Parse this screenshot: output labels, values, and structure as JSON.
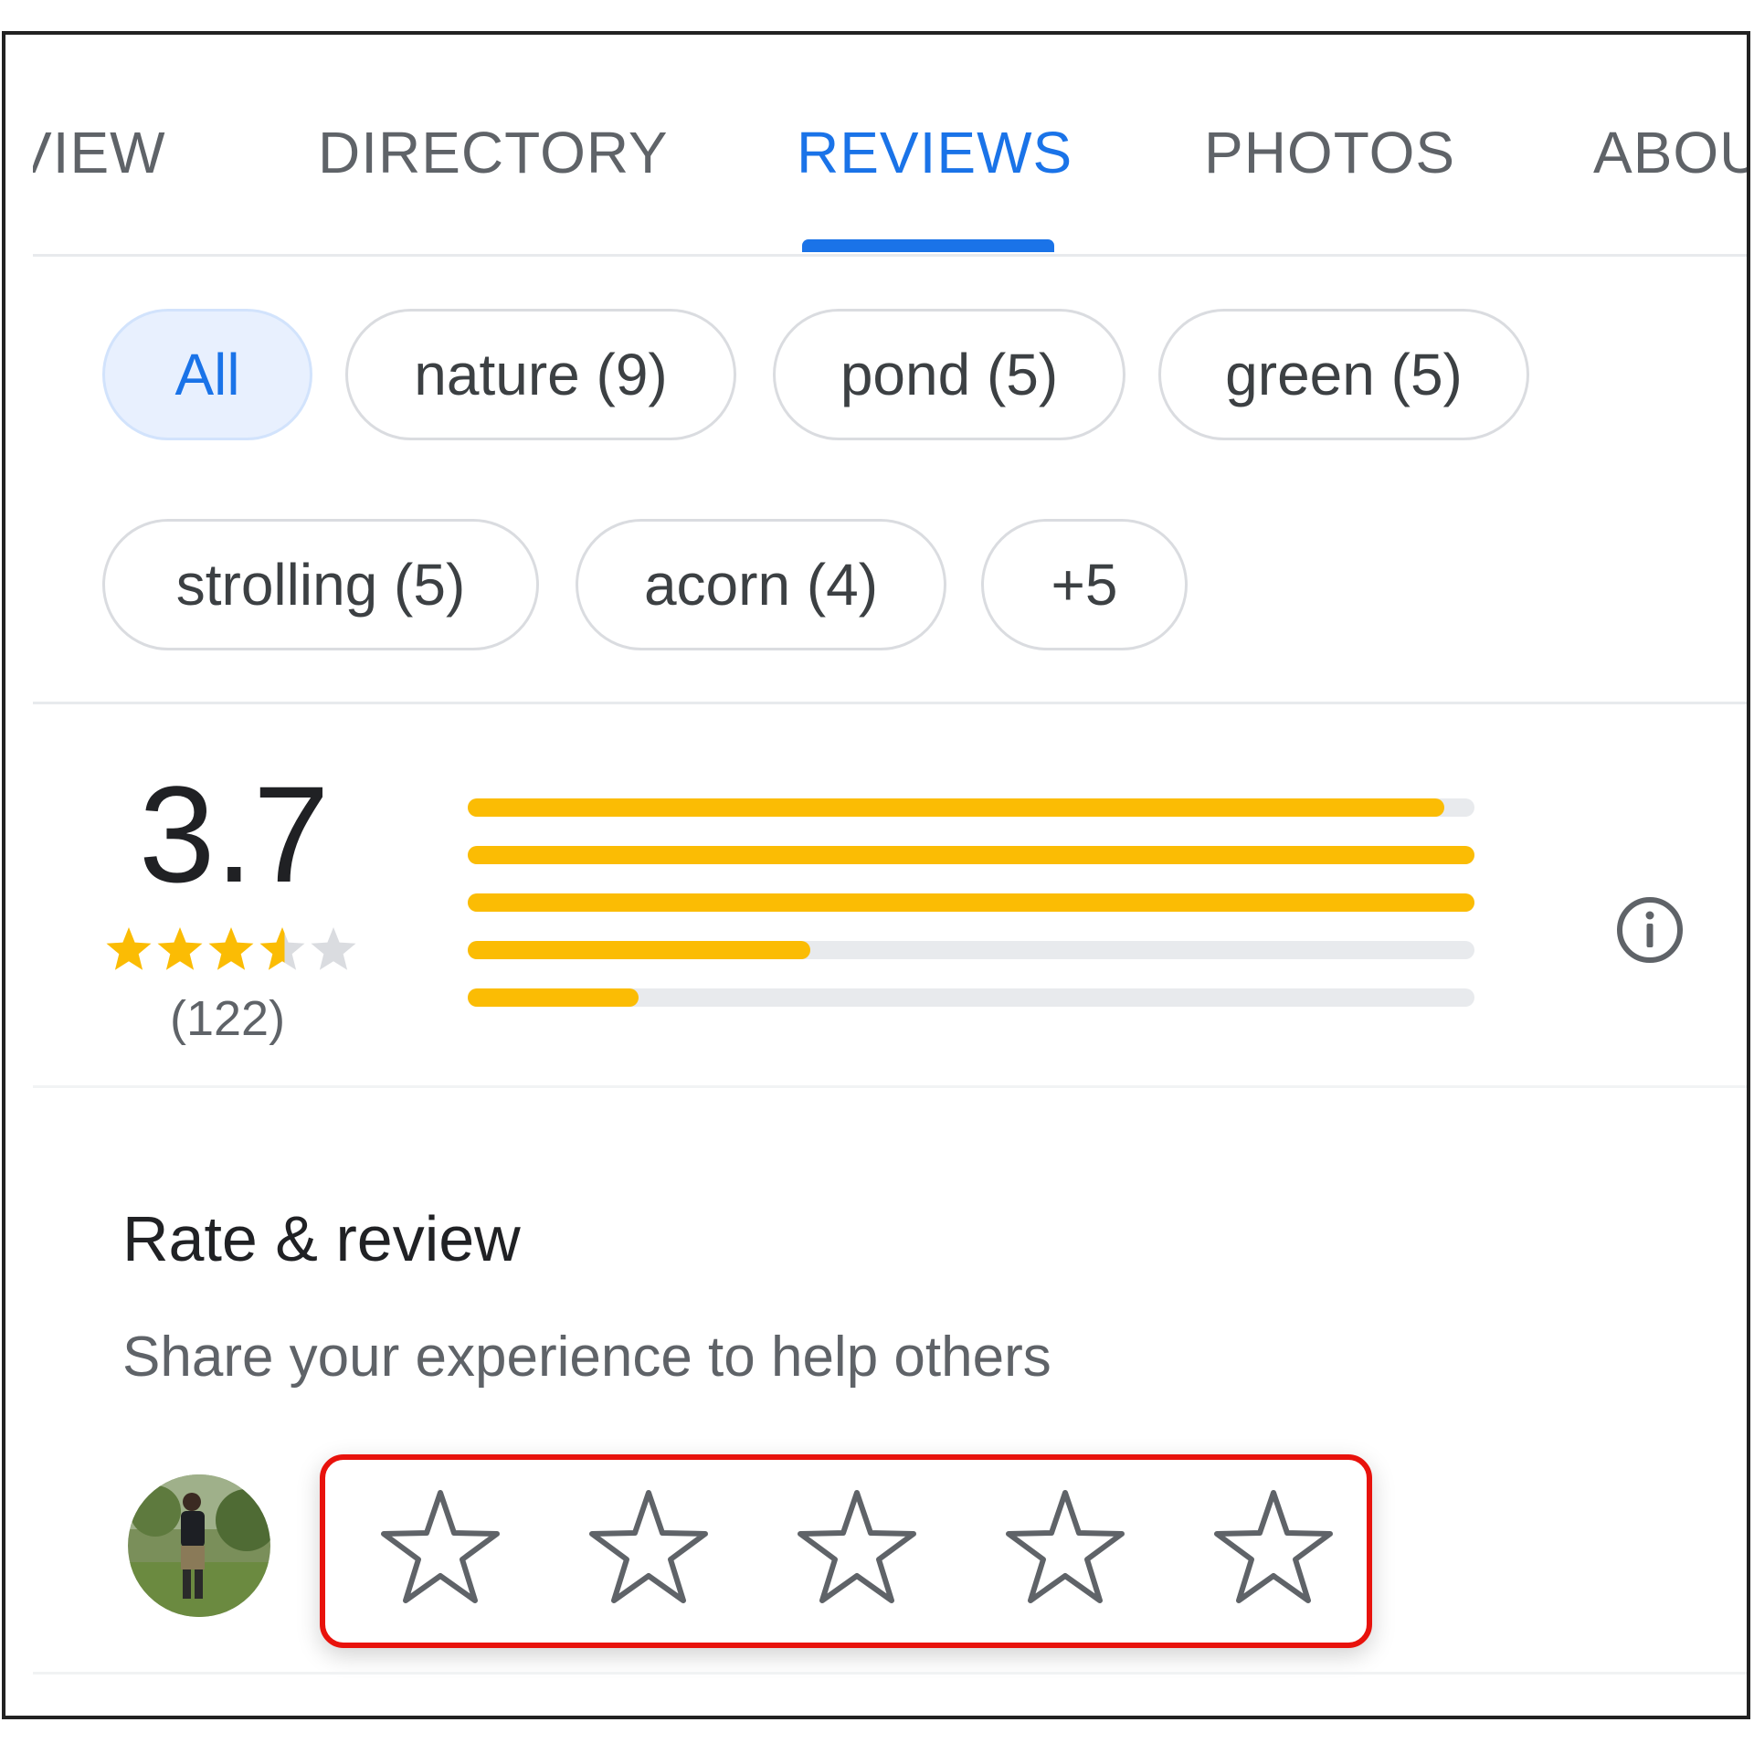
{
  "tabs": [
    {
      "label": "VIEW",
      "active": false
    },
    {
      "label": "DIRECTORY",
      "active": false
    },
    {
      "label": "REVIEWS",
      "active": true
    },
    {
      "label": "PHOTOS",
      "active": false
    },
    {
      "label": "ABOU",
      "active": false
    }
  ],
  "filters": [
    {
      "label": "All",
      "selected": true
    },
    {
      "label": "nature (9)",
      "selected": false
    },
    {
      "label": "pond (5)",
      "selected": false
    },
    {
      "label": "green (5)",
      "selected": false
    },
    {
      "label": "strolling (5)",
      "selected": false
    },
    {
      "label": "acorn (4)",
      "selected": false
    },
    {
      "label": "+5",
      "selected": false
    }
  ],
  "summary": {
    "rating": "3.7",
    "rating_value": 3.7,
    "review_count": "(122)",
    "distribution": [
      {
        "stars": 5,
        "fraction": 0.97
      },
      {
        "stars": 4,
        "fraction": 1.0
      },
      {
        "stars": 3,
        "fraction": 1.0
      },
      {
        "stars": 2,
        "fraction": 0.34
      },
      {
        "stars": 1,
        "fraction": 0.17
      }
    ]
  },
  "rate_review": {
    "title": "Rate & review",
    "subtitle": "Share your experience to help others",
    "star_count": 5
  },
  "colors": {
    "accent": "#1a73e8",
    "star": "#fbbc04",
    "track": "#e8eaed",
    "highlight": "#e8120c"
  },
  "icons": {
    "info": "info-circle-icon",
    "rating_star": "star-outline-icon"
  }
}
